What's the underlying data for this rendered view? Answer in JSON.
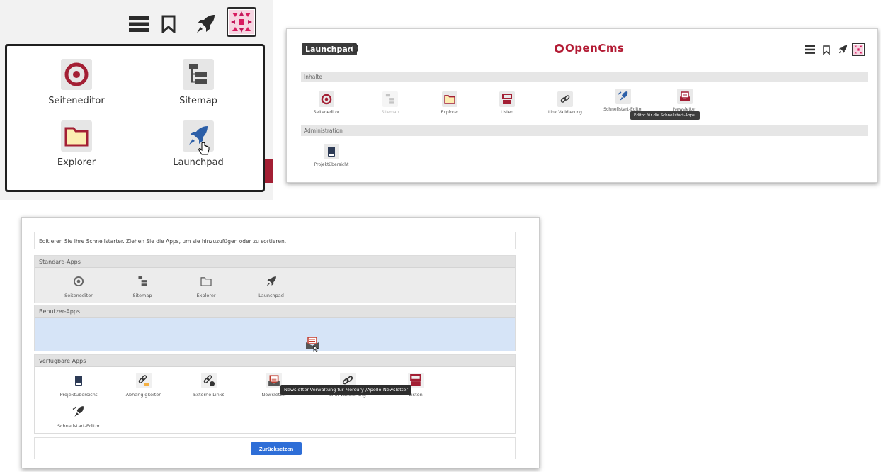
{
  "toolbar": {
    "icons": [
      "hamburger-icon",
      "bookmark-icon",
      "rocket-icon",
      "user-avatar"
    ]
  },
  "dropdown": {
    "items": [
      {
        "label": "Seiteneditor",
        "icon": "page-editor-icon"
      },
      {
        "label": "Sitemap",
        "icon": "sitemap-icon"
      },
      {
        "label": "Explorer",
        "icon": "folder-icon"
      },
      {
        "label": "Launchpad",
        "icon": "rocket-icon"
      }
    ]
  },
  "launchpad": {
    "badge": "Launchpad",
    "logo": "OpenCms",
    "sections": {
      "content": "Inhalte",
      "admin": "Administration"
    },
    "content_apps": [
      {
        "label": "Seiteneditor",
        "icon": "page-editor-icon"
      },
      {
        "label": "Sitemap",
        "icon": "sitemap-icon"
      },
      {
        "label": "Explorer",
        "icon": "folder-icon"
      },
      {
        "label": "Listen",
        "icon": "lists-icon"
      },
      {
        "label": "Link Validierung",
        "icon": "link-icon"
      },
      {
        "label": "Schnellstart-Editor",
        "icon": "quick-launch-editor-icon"
      },
      {
        "label": "Newsletter",
        "icon": "newsletter-icon"
      }
    ],
    "admin_apps": [
      {
        "label": "Projektübersicht",
        "icon": "project-book-icon"
      }
    ],
    "tooltip": "Editor für die Schnellstart-Apps."
  },
  "editor": {
    "intro": "Editieren Sie Ihre Schnellstarter. Ziehen Sie die Apps, um sie hinzuzufügen oder zu sortieren.",
    "standard_title": "Standard-Apps",
    "standard_apps": [
      {
        "label": "Seiteneditor",
        "icon": "page-editor-icon"
      },
      {
        "label": "Sitemap",
        "icon": "sitemap-icon"
      },
      {
        "label": "Explorer",
        "icon": "folder-icon"
      },
      {
        "label": "Launchpad",
        "icon": "rocket-icon"
      }
    ],
    "user_title": "Benutzer-Apps",
    "available_title": "Verfügbare Apps",
    "available_apps": [
      {
        "label": "Projektübersicht",
        "icon": "project-book-icon"
      },
      {
        "label": "Abhängigkeiten",
        "icon": "dependencies-icon"
      },
      {
        "label": "Externe Links",
        "icon": "external-links-icon"
      },
      {
        "label": "Newsletter",
        "icon": "newsletter-icon"
      },
      {
        "label": "Link Validierung",
        "icon": "link-icon"
      },
      {
        "label": "Listen",
        "icon": "lists-icon"
      },
      {
        "label": "Schnellstart-Editor",
        "icon": "quick-launch-editor-icon"
      }
    ],
    "tooltip": "Newsletter-Verwaltung für Mercury-/Apollo-Newsletter",
    "reset_label": "Zurücksetzen"
  },
  "colors": {
    "accent_red": "#b31b34",
    "button_blue": "#2e6ed7",
    "drop_zone": "#d6e4f7"
  }
}
